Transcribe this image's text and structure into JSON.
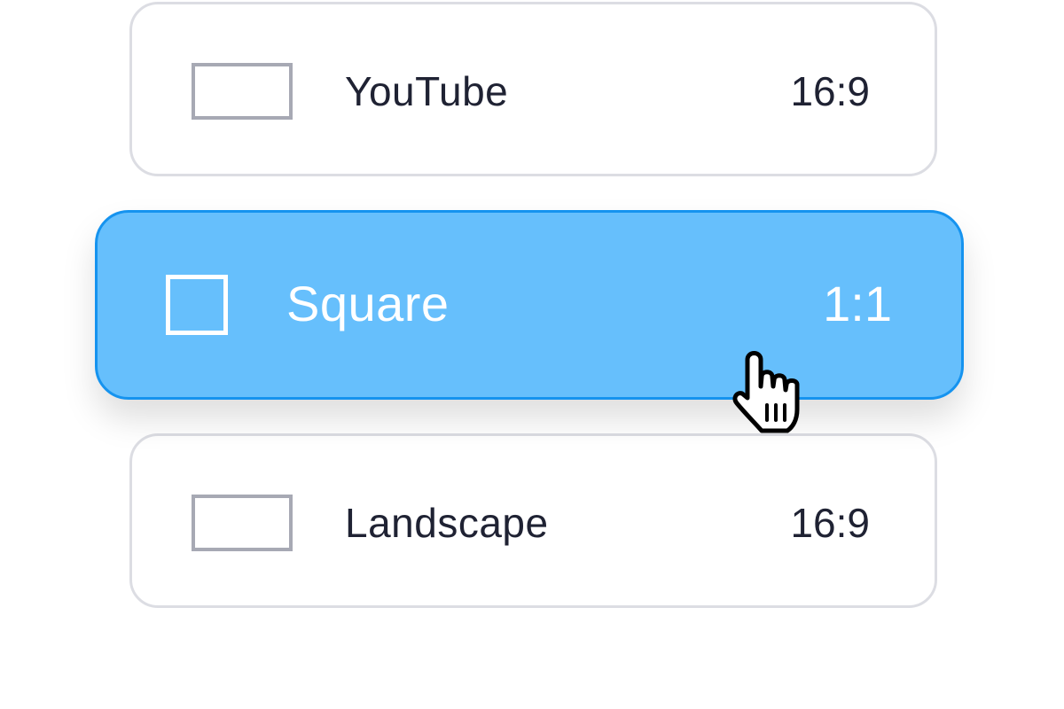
{
  "options": [
    {
      "label": "YouTube",
      "ratio": "16:9",
      "icon": "landscape-frame-icon",
      "selected": false
    },
    {
      "label": "Square",
      "ratio": "1:1",
      "icon": "square-frame-icon",
      "selected": true
    },
    {
      "label": "Landscape",
      "ratio": "16:9",
      "icon": "landscape-frame-icon",
      "selected": false
    }
  ],
  "colors": {
    "selected_fill": "#66bffc",
    "selected_border": "#1593ef",
    "card_border": "#dcdde3",
    "frame_icon": "#a7a9b4",
    "text": "#1f2233"
  },
  "cursor": {
    "icon": "hand-pointer-cursor-icon"
  }
}
